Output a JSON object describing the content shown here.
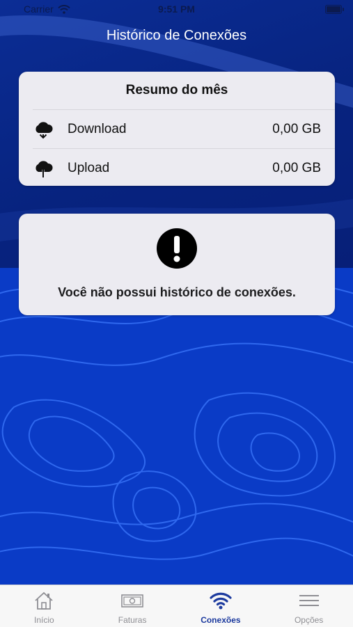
{
  "status_bar": {
    "carrier": "Carrier",
    "time": "9:51 PM"
  },
  "header": {
    "title": "Histórico de Conexões"
  },
  "summary": {
    "title": "Resumo do mês",
    "rows": [
      {
        "label": "Download",
        "value": "0,00 GB",
        "icon": "cloud-download-icon"
      },
      {
        "label": "Upload",
        "value": "0,00 GB",
        "icon": "cloud-upload-icon"
      }
    ]
  },
  "empty_state": {
    "message": "Você não possui histórico de conexões.",
    "icon": "exclamation-circle-icon"
  },
  "tabs": [
    {
      "label": "Início",
      "icon": "home-icon",
      "active": false
    },
    {
      "label": "Faturas",
      "icon": "banknote-icon",
      "active": false
    },
    {
      "label": "Conexões",
      "icon": "wifi-icon",
      "active": true
    },
    {
      "label": "Opções",
      "icon": "menu-icon",
      "active": false
    }
  ],
  "colors": {
    "accent": "#1c3a9e",
    "inactive": "#8e8e93",
    "background": "#0a2a8c"
  }
}
